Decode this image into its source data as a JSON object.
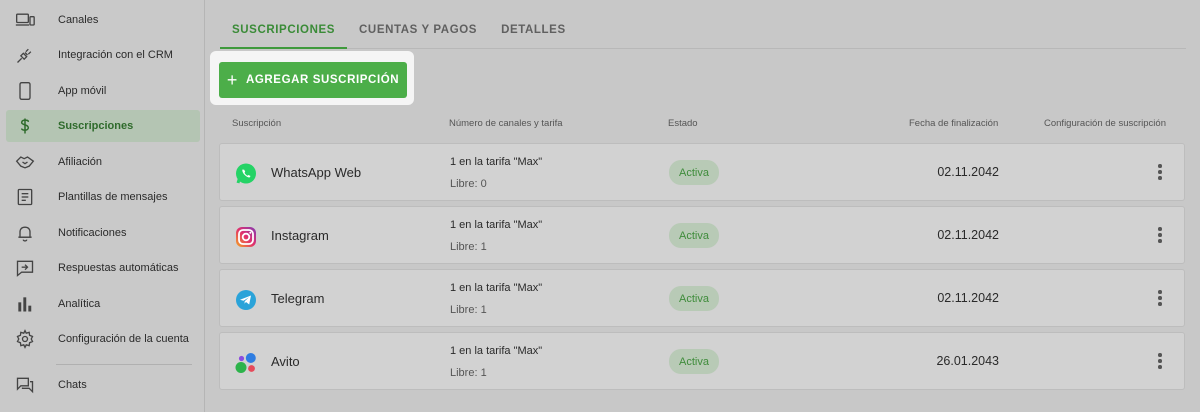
{
  "sidebar": {
    "items": [
      {
        "label": "Canales",
        "icon": "devices-icon"
      },
      {
        "label": "Integración con el CRM",
        "icon": "plug-icon"
      },
      {
        "label": "App móvil",
        "icon": "phone-icon"
      },
      {
        "label": "Suscripciones",
        "icon": "dollar-icon"
      },
      {
        "label": "Afiliación",
        "icon": "handshake-icon"
      },
      {
        "label": "Plantillas de mensajes",
        "icon": "template-icon"
      },
      {
        "label": "Notificaciones",
        "icon": "bell-icon"
      },
      {
        "label": "Respuestas automáticas",
        "icon": "auto-reply-icon"
      },
      {
        "label": "Analítica",
        "icon": "bar-chart-icon"
      },
      {
        "label": "Configuración de la cuenta",
        "icon": "gear-icon"
      },
      {
        "label": "Chats",
        "icon": "chat-icon"
      }
    ],
    "active_index": 3
  },
  "tabs": [
    {
      "label": "SUSCRIPCIONES",
      "active": true
    },
    {
      "label": "CUENTAS Y PAGOS",
      "active": false
    },
    {
      "label": "DETALLES",
      "active": false
    }
  ],
  "add_button": {
    "icon": "plus-icon",
    "label": "AGREGAR SUSCRIPCIÓN"
  },
  "table": {
    "headers": {
      "subscription": "Suscripción",
      "channels": "Número de canales y tarifa",
      "status": "Estado",
      "end_date": "Fecha de finalización",
      "config": "Configuración de suscripción"
    },
    "rows": [
      {
        "name": "WhatsApp Web",
        "icon": "whatsapp-icon",
        "plan": "1 en la tarifa \"Max\"",
        "free": "Libre: 0",
        "status": "Activa",
        "date": "02.11.2042"
      },
      {
        "name": "Instagram",
        "icon": "instagram-icon",
        "plan": "1 en la tarifa \"Max\"",
        "free": "Libre: 1",
        "status": "Activa",
        "date": "02.11.2042"
      },
      {
        "name": "Telegram",
        "icon": "telegram-icon",
        "plan": "1 en la tarifa \"Max\"",
        "free": "Libre: 1",
        "status": "Activa",
        "date": "02.11.2042"
      },
      {
        "name": "Avito",
        "icon": "avito-icon",
        "plan": "1 en la tarifa \"Max\"",
        "free": "Libre: 1",
        "status": "Activa",
        "date": "26.01.2043"
      }
    ]
  },
  "colors": {
    "accent": "#4cae49",
    "status_text": "#3f8c3b",
    "status_bg": "#b8cab6",
    "whatsapp": "#25d366",
    "telegram": "#2aa3d9"
  }
}
